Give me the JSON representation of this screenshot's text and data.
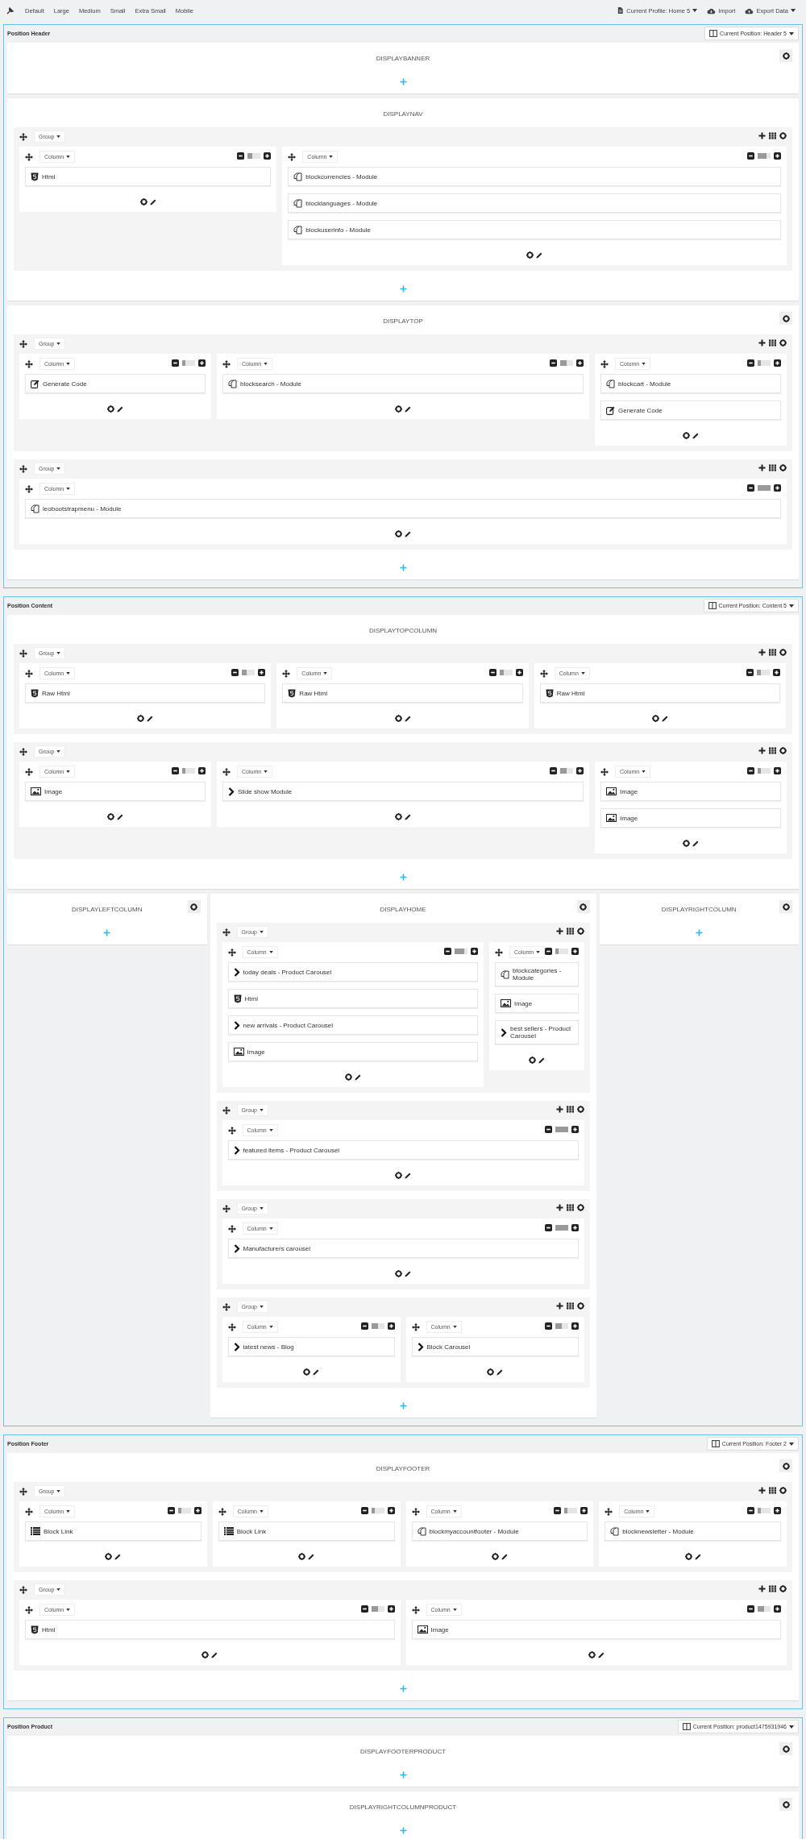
{
  "toolbar": {
    "sizes": [
      "Default",
      "Large",
      "Medium",
      "Small",
      "Extra Small",
      "Mobile"
    ],
    "actions": [
      {
        "kind": "profile",
        "label": "Current Profile: Home 5",
        "dropdown": true
      },
      {
        "kind": "import",
        "label": "Import",
        "dropdown": false
      },
      {
        "kind": "export",
        "label": "Export Data",
        "dropdown": true
      }
    ]
  },
  "positions": [
    {
      "title": "Position Header",
      "current": "Current Position: Header 5",
      "rows": [
        {
          "hooks": [
            {
              "name": "DISPLAYBANNER",
              "settings": true
            }
          ]
        },
        {
          "hooks": [
            {
              "name": "DISPLAYNAV",
              "settings": false,
              "groups": [
                {
                  "label": "Group",
                  "columns": [
                    {
                      "label": "Column",
                      "level": 0.333,
                      "widgets": [
                        {
                          "kind": "html",
                          "label": "Html"
                        }
                      ]
                    },
                    {
                      "label": "Column",
                      "level": 0.667,
                      "widgets": [
                        {
                          "kind": "module",
                          "label": "blockcurrencies - Module"
                        },
                        {
                          "kind": "module",
                          "label": "blocklanguages - Module"
                        },
                        {
                          "kind": "module",
                          "label": "blockuserinfo - Module"
                        }
                      ]
                    }
                  ]
                }
              ]
            }
          ]
        },
        {
          "hooks": [
            {
              "name": "DISPLAYTOP",
              "settings": true,
              "groups": [
                {
                  "label": "Group",
                  "columns": [
                    {
                      "label": "Column",
                      "level": 0.25,
                      "widgets": [
                        {
                          "kind": "code",
                          "label": "Generate Code"
                        }
                      ]
                    },
                    {
                      "label": "Column",
                      "level": 0.5,
                      "widgets": [
                        {
                          "kind": "module",
                          "label": "blocksearch - Module"
                        }
                      ]
                    },
                    {
                      "label": "Column",
                      "level": 0.25,
                      "widgets": [
                        {
                          "kind": "module",
                          "label": "blockcart - Module"
                        },
                        {
                          "kind": "code",
                          "label": "Generate Code"
                        }
                      ]
                    }
                  ]
                },
                {
                  "label": "Group",
                  "columns": [
                    {
                      "label": "Column",
                      "level": 1,
                      "widgets": [
                        {
                          "kind": "module",
                          "label": "leobootstrapmenu - Module"
                        }
                      ]
                    }
                  ]
                }
              ]
            }
          ]
        }
      ]
    },
    {
      "title": "Position Content",
      "current": "Current Position: Content 5",
      "rows": [
        {
          "hooks": [
            {
              "name": "DISPLAYTOPCOLUMN",
              "settings": false,
              "groups": [
                {
                  "label": "Group",
                  "columns": [
                    {
                      "label": "Column",
                      "level": 0.333,
                      "widgets": [
                        {
                          "kind": "html",
                          "label": "Raw Html"
                        }
                      ]
                    },
                    {
                      "label": "Column",
                      "level": 0.333,
                      "widgets": [
                        {
                          "kind": "html",
                          "label": "Raw Html"
                        }
                      ]
                    },
                    {
                      "label": "Column",
                      "level": 0.333,
                      "widgets": [
                        {
                          "kind": "html",
                          "label": "Raw Html"
                        }
                      ]
                    }
                  ]
                },
                {
                  "label": "Group",
                  "columns": [
                    {
                      "label": "Column",
                      "level": 0.25,
                      "widgets": [
                        {
                          "kind": "image",
                          "label": "Image"
                        }
                      ]
                    },
                    {
                      "label": "Column",
                      "level": 0.5,
                      "widgets": [
                        {
                          "kind": "chevron",
                          "label": "Slide show Module"
                        }
                      ]
                    },
                    {
                      "label": "Column",
                      "level": 0.25,
                      "widgets": [
                        {
                          "kind": "image",
                          "label": "Image"
                        },
                        {
                          "kind": "image",
                          "label": "Image"
                        }
                      ]
                    }
                  ]
                }
              ]
            }
          ]
        },
        {
          "hooks": [
            {
              "name": "DISPLAYLEFTCOLUMN",
              "settings": true
            },
            {
              "name": "DISPLAYHOME",
              "settings": true,
              "groups": [
                {
                  "label": "Group",
                  "columns": [
                    {
                      "label": "Column",
                      "level": 0.75,
                      "widgets": [
                        {
                          "kind": "chevron",
                          "label": "today deals - Product Carousel"
                        },
                        {
                          "kind": "html",
                          "label": "Html"
                        },
                        {
                          "kind": "chevron",
                          "label": "new arrivals - Product Carousel"
                        },
                        {
                          "kind": "image",
                          "label": "Image"
                        }
                      ]
                    },
                    {
                      "label": "Column",
                      "level": 0.25,
                      "widgets": [
                        {
                          "kind": "module",
                          "label": "blockcategories - Module"
                        },
                        {
                          "kind": "image",
                          "label": "Image"
                        },
                        {
                          "kind": "chevron",
                          "label": "best sellers - Product Carousel"
                        }
                      ]
                    }
                  ]
                },
                {
                  "label": "Group",
                  "columns": [
                    {
                      "label": "Column",
                      "level": 1,
                      "widgets": [
                        {
                          "kind": "chevron",
                          "label": "featured items - Product Carousel"
                        }
                      ]
                    }
                  ]
                },
                {
                  "label": "Group",
                  "columns": [
                    {
                      "label": "Column",
                      "level": 1,
                      "widgets": [
                        {
                          "kind": "chevron",
                          "label": "Manufacturers carousel"
                        }
                      ]
                    }
                  ]
                },
                {
                  "label": "Group",
                  "columns": [
                    {
                      "label": "Column",
                      "level": 0.5,
                      "widgets": [
                        {
                          "kind": "chevron",
                          "label": "latest news - Blog"
                        }
                      ]
                    },
                    {
                      "label": "Column",
                      "level": 0.5,
                      "widgets": [
                        {
                          "kind": "chevron",
                          "label": "Block Carousel"
                        }
                      ]
                    }
                  ]
                }
              ]
            },
            {
              "name": "DISPLAYRIGHTCOLUMN",
              "settings": true
            }
          ]
        }
      ]
    },
    {
      "title": "Position Footer",
      "current": "Current Position: Footer 2",
      "rows": [
        {
          "hooks": [
            {
              "name": "DISPLAYFOOTER",
              "settings": true,
              "groups": [
                {
                  "label": "Group",
                  "columns": [
                    {
                      "label": "Column",
                      "level": 0.25,
                      "widgets": [
                        {
                          "kind": "list",
                          "label": "Block Link"
                        }
                      ]
                    },
                    {
                      "label": "Column",
                      "level": 0.25,
                      "widgets": [
                        {
                          "kind": "list",
                          "label": "Block Link"
                        }
                      ]
                    },
                    {
                      "label": "Column",
                      "level": 0.25,
                      "widgets": [
                        {
                          "kind": "module",
                          "label": "blockmyaccountfooter - Module"
                        }
                      ]
                    },
                    {
                      "label": "Column",
                      "level": 0.25,
                      "widgets": [
                        {
                          "kind": "module",
                          "label": "blocknewsletter - Module"
                        }
                      ]
                    }
                  ]
                },
                {
                  "label": "Group",
                  "columns": [
                    {
                      "label": "Column",
                      "level": 0.5,
                      "widgets": [
                        {
                          "kind": "html",
                          "label": "Html"
                        }
                      ]
                    },
                    {
                      "label": "Column",
                      "level": 0.5,
                      "widgets": [
                        {
                          "kind": "image",
                          "label": "Image"
                        }
                      ]
                    }
                  ]
                }
              ]
            }
          ]
        }
      ]
    },
    {
      "title": "Position Product",
      "current": "Current Position: product1475931946",
      "rows": [
        {
          "hooks": [
            {
              "name": "DISPLAYFOOTERPRODUCT",
              "settings": true
            }
          ]
        },
        {
          "hooks": [
            {
              "name": "DISPLAYRIGHTCOLUMNPRODUCT",
              "settings": true
            }
          ]
        }
      ]
    }
  ]
}
